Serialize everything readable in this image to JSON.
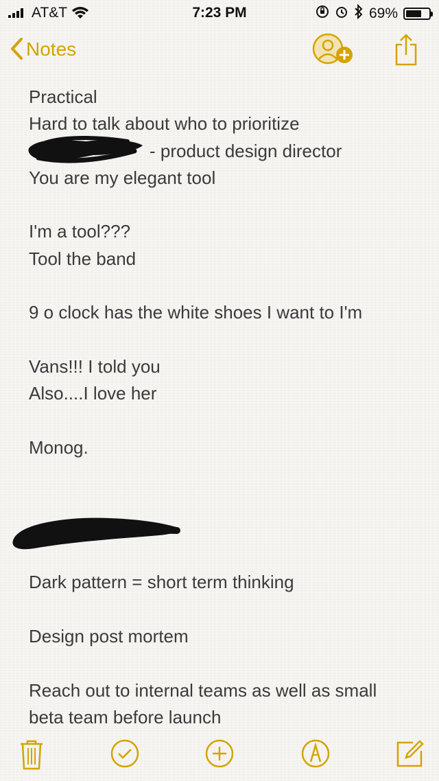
{
  "status": {
    "carrier": "AT&T",
    "time": "7:23 PM",
    "battery": "69%"
  },
  "nav": {
    "back_label": "Notes"
  },
  "colors": {
    "accent": "#d4a300",
    "text": "#3a3a3a"
  },
  "note": {
    "lines": [
      "Practical",
      "Hard to talk about who to prioritize",
      "- product design director",
      "You are my elegant tool",
      "",
      "I'm a tool???",
      "Tool the band",
      "",
      "9 o clock has the white shoes I want to I'm",
      "",
      "Vans!!! I told you",
      "Also....I love her",
      "",
      "Monog.",
      "",
      "",
      "",
      "",
      "Dark pattern = short term thinking",
      "",
      "Design post mortem",
      "",
      "Reach out to internal teams as well as small",
      "beta team before launch"
    ]
  },
  "icons": {
    "back": "chevron-left-icon",
    "collab": "add-person-icon",
    "share": "share-icon",
    "trash": "trash-icon",
    "checklist": "checkmark-circle-icon",
    "add": "plus-circle-icon",
    "markup": "pen-circle-icon",
    "compose": "compose-icon"
  }
}
